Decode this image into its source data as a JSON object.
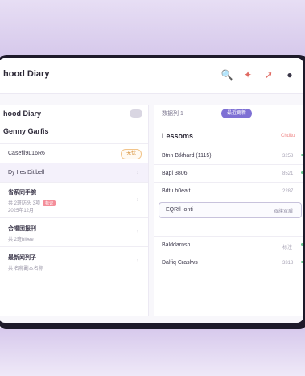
{
  "app": {
    "title": "hood Diary"
  },
  "topbar_icons": [
    "search-icon",
    "pin-icon",
    "share-icon",
    "user-icon"
  ],
  "left_panel": {
    "title": "hood Diary",
    "subtitle": "Genny Garfis",
    "items": [
      {
        "title": "Casefil9L16R6",
        "badge": "无忧"
      },
      {
        "title": "Dy Ires Ditibell"
      },
      {
        "title": "省系同手腕",
        "sub": "共 2班防头 3项",
        "sub2": "2025年12月",
        "tag": "标记"
      },
      {
        "title": "合唱团报刊",
        "sub": "共 2班hi0ee"
      },
      {
        "title": "最新闻列子",
        "sub": "共 名称副本名称"
      }
    ]
  },
  "right_panel": {
    "pill_left": "数据列 1",
    "pill_active": "最近更新",
    "header": "Lessoms",
    "header_right": "Chditu",
    "rows": [
      {
        "label": "Btnn Btkhard (1115)",
        "right": "3258"
      },
      {
        "label": "Bapi 3806",
        "right": "8521"
      },
      {
        "label": "Bdtu b0ealt",
        "right": "2287"
      }
    ],
    "highlight": {
      "label": "EQRfl Ionti",
      "right": "双旗双盾"
    },
    "rows2": [
      {
        "label": "Balddarnsh",
        "right": "标注"
      },
      {
        "label": "Dalfiq Craslws",
        "right": "3318"
      }
    ]
  }
}
